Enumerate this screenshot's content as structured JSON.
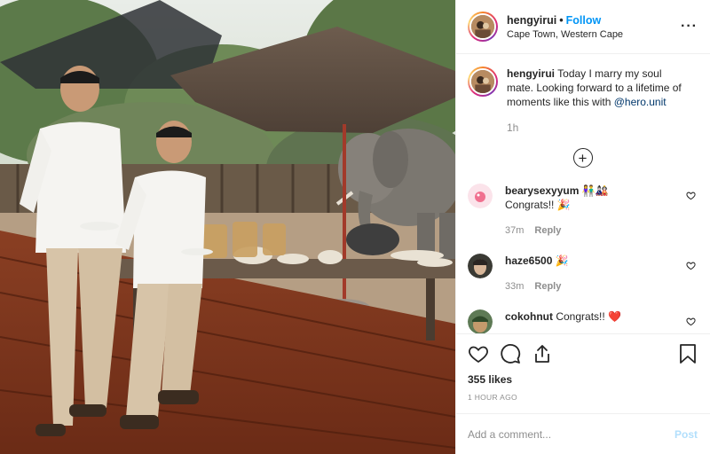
{
  "header": {
    "username": "hengyirui",
    "separator": "•",
    "follow_label": "Follow",
    "location": "Cape Town, Western Cape",
    "more_label": "···"
  },
  "caption": {
    "username": "hengyirui",
    "text": "Today I marry my soul mate. Looking forward to a lifetime of moments like this with",
    "mention": "@hero.unit",
    "time": "1h"
  },
  "load_more_label": "+",
  "comments": [
    {
      "username": "bearysexyyum",
      "text": "👫🎎 Congrats!! 🎉",
      "time": "37m",
      "reply": "Reply"
    },
    {
      "username": "haze6500",
      "text": "🎉",
      "time": "33m",
      "reply": "Reply"
    },
    {
      "username": "cokohnut",
      "text": "Congrats!! ❤️",
      "time": "",
      "reply": ""
    }
  ],
  "likes": "355 likes",
  "posted_ago": "1 HOUR AGO",
  "comment_input": {
    "placeholder": "Add a comment..."
  },
  "post_label": "Post",
  "colors": {
    "link": "#0095f6",
    "muted": "#8e8e8e",
    "post_disabled": "#b2dffc"
  }
}
